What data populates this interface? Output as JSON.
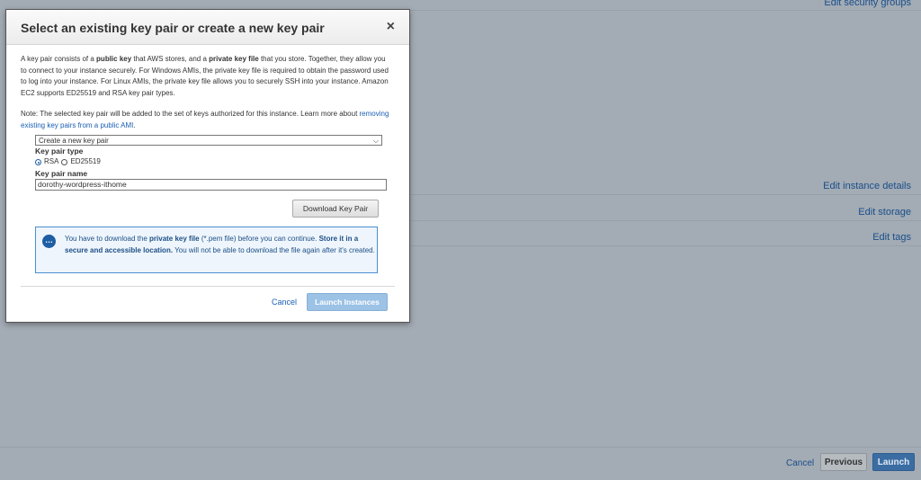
{
  "background": {
    "edit_security_groups": "Edit security groups",
    "edit_instance_details": "Edit instance details",
    "edit_storage": "Edit storage",
    "edit_tags": "Edit tags",
    "footer": {
      "cancel": "Cancel",
      "previous": "Previous",
      "launch": "Launch"
    }
  },
  "modal": {
    "title": "Select an existing key pair or create a new key pair",
    "close_icon": "×",
    "description": {
      "t1": "A key pair consists of a ",
      "b1": "public key",
      "t2": " that AWS stores, and a ",
      "b2": "private key file",
      "t3": " that you store. Together, they allow you to connect to your instance securely. For Windows AMIs, the private key file is required to obtain the password used to log into your instance. For Linux AMIs, the private key file allows you to securely SSH into your instance. Amazon EC2 supports ED25519 and RSA key pair types."
    },
    "note": {
      "text": "Note: The selected key pair will be added to the set of keys authorized for this instance. Learn more about ",
      "link": "removing existing key pairs from a public AMI",
      "end": "."
    },
    "keypair_select": {
      "selected": "Create a new key pair",
      "chevron_icon": "chevron-down-icon"
    },
    "key_pair_type_label": "Key pair type",
    "key_pair_types": [
      {
        "label": "RSA",
        "checked": true
      },
      {
        "label": "ED25519",
        "checked": false
      }
    ],
    "key_pair_name_label": "Key pair name",
    "key_pair_name_value": "dorothy-wordpress-ithome",
    "download_button": "Download Key Pair",
    "info": {
      "icon": "chat-bubble-icon",
      "t1": "You have to download the ",
      "b1": "private key file",
      "t2": " (*.pem file) before you can continue. ",
      "b2": "Store it in a secure and accessible location.",
      "t3": " You will not be able to download the file again after it's created."
    },
    "cancel": "Cancel",
    "launch_instances": "Launch Instances"
  }
}
